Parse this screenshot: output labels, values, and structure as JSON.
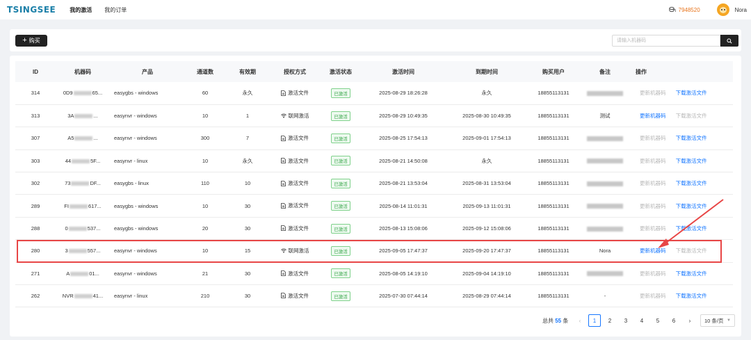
{
  "app": {
    "logo": "TSINGSEE"
  },
  "nav": {
    "items": [
      "我的激活",
      "我的订单"
    ]
  },
  "user": {
    "coins": "7948520",
    "name": "Nora"
  },
  "toolbar": {
    "buy_label": "购买"
  },
  "search": {
    "placeholder": "请输入机器码"
  },
  "table": {
    "headers": [
      "ID",
      "机器码",
      "产品",
      "通道数",
      "有效期",
      "授权方式",
      "激活状态",
      "激活时间",
      "到期时间",
      "购买用户",
      "备注",
      "操作"
    ],
    "actions": {
      "update_machine": "更新机器码",
      "download_file": "下载激活文件"
    },
    "rows": [
      {
        "id": "314",
        "mc_pre": "0D9",
        "mc_suf": "65...",
        "product": "easygbs - windows",
        "channels": "60",
        "validity": "永久",
        "auth": "激活文件",
        "auth_type": "file",
        "status": "已激活",
        "activated": "2025-08-29 18:26:28",
        "expires": "永久",
        "buyer": "18855113131",
        "note": "",
        "update_enabled": false,
        "download_enabled": true
      },
      {
        "id": "313",
        "mc_pre": "3A",
        "mc_suf": "...",
        "product": "easynvr - windows",
        "channels": "10",
        "validity": "1",
        "auth": "联网激活",
        "auth_type": "online",
        "status": "已激活",
        "activated": "2025-08-29 10:49:35",
        "expires": "2025-08-30 10:49:35",
        "buyer": "18855113131",
        "note": "测试",
        "update_enabled": true,
        "download_enabled": false
      },
      {
        "id": "307",
        "mc_pre": "A5",
        "mc_suf": "...",
        "product": "easynvr - windows",
        "channels": "300",
        "validity": "7",
        "auth": "激活文件",
        "auth_type": "file",
        "status": "已激活",
        "activated": "2025-08-25 17:54:13",
        "expires": "2025-09-01 17:54:13",
        "buyer": "18855113131",
        "note": "",
        "update_enabled": false,
        "download_enabled": true
      },
      {
        "id": "303",
        "mc_pre": "44",
        "mc_suf": "5F...",
        "product": "easynvr - linux",
        "channels": "10",
        "validity": "永久",
        "auth": "激活文件",
        "auth_type": "file",
        "status": "已激活",
        "activated": "2025-08-21 14:50:08",
        "expires": "永久",
        "buyer": "18855113131",
        "note": "",
        "update_enabled": false,
        "download_enabled": true
      },
      {
        "id": "302",
        "mc_pre": "73",
        "mc_suf": "DF...",
        "product": "easygbs - linux",
        "channels": "110",
        "validity": "10",
        "auth": "激活文件",
        "auth_type": "file",
        "status": "已激活",
        "activated": "2025-08-21 13:53:04",
        "expires": "2025-08-31 13:53:04",
        "buyer": "18855113131",
        "note": "",
        "update_enabled": false,
        "download_enabled": true
      },
      {
        "id": "289",
        "mc_pre": "FI",
        "mc_suf": "617...",
        "product": "easygbs - windows",
        "channels": "10",
        "validity": "30",
        "auth": "激活文件",
        "auth_type": "file",
        "status": "已激活",
        "activated": "2025-08-14 11:01:31",
        "expires": "2025-09-13 11:01:31",
        "buyer": "18855113131",
        "note": "",
        "update_enabled": false,
        "download_enabled": true
      },
      {
        "id": "288",
        "mc_pre": "0",
        "mc_suf": "537...",
        "product": "easygbs - windows",
        "channels": "20",
        "validity": "30",
        "auth": "激活文件",
        "auth_type": "file",
        "status": "已激活",
        "activated": "2025-08-13 15:08:06",
        "expires": "2025-09-12 15:08:06",
        "buyer": "18855113131",
        "note": "",
        "update_enabled": false,
        "download_enabled": true
      },
      {
        "id": "280",
        "mc_pre": "3",
        "mc_suf": "557...",
        "product": "easynvr - windows",
        "channels": "10",
        "validity": "15",
        "auth": "联网激活",
        "auth_type": "online",
        "status": "已激活",
        "activated": "2025-09-05 17:47:37",
        "expires": "2025-09-20 17:47:37",
        "buyer": "18855113131",
        "note": "Nora",
        "update_enabled": true,
        "download_enabled": false
      },
      {
        "id": "271",
        "mc_pre": "A",
        "mc_suf": "01...",
        "product": "easynvr - windows",
        "channels": "21",
        "validity": "30",
        "auth": "激活文件",
        "auth_type": "file",
        "status": "已激活",
        "activated": "2025-08-05 14:19:10",
        "expires": "2025-09-04 14:19:10",
        "buyer": "18855113131",
        "note": "",
        "update_enabled": false,
        "download_enabled": true
      },
      {
        "id": "262",
        "mc_pre": "NVR",
        "mc_suf": "41...",
        "product": "easynvr - linux",
        "channels": "210",
        "validity": "30",
        "auth": "激活文件",
        "auth_type": "file",
        "status": "已激活",
        "activated": "2025-07-30 07:44:14",
        "expires": "2025-08-29 07:44:14",
        "buyer": "18855113131",
        "note": "-",
        "update_enabled": false,
        "download_enabled": true
      }
    ]
  },
  "pagination": {
    "total_prefix": "总共",
    "total": "55",
    "total_suffix": "条",
    "pages": [
      "1",
      "2",
      "3",
      "4",
      "5",
      "6"
    ],
    "current": "1",
    "page_size": "10 条/页"
  },
  "colors": {
    "accent": "#1677ff",
    "status_green": "#3aa74c",
    "highlight": "#e84646",
    "coins": "#e8741c"
  }
}
